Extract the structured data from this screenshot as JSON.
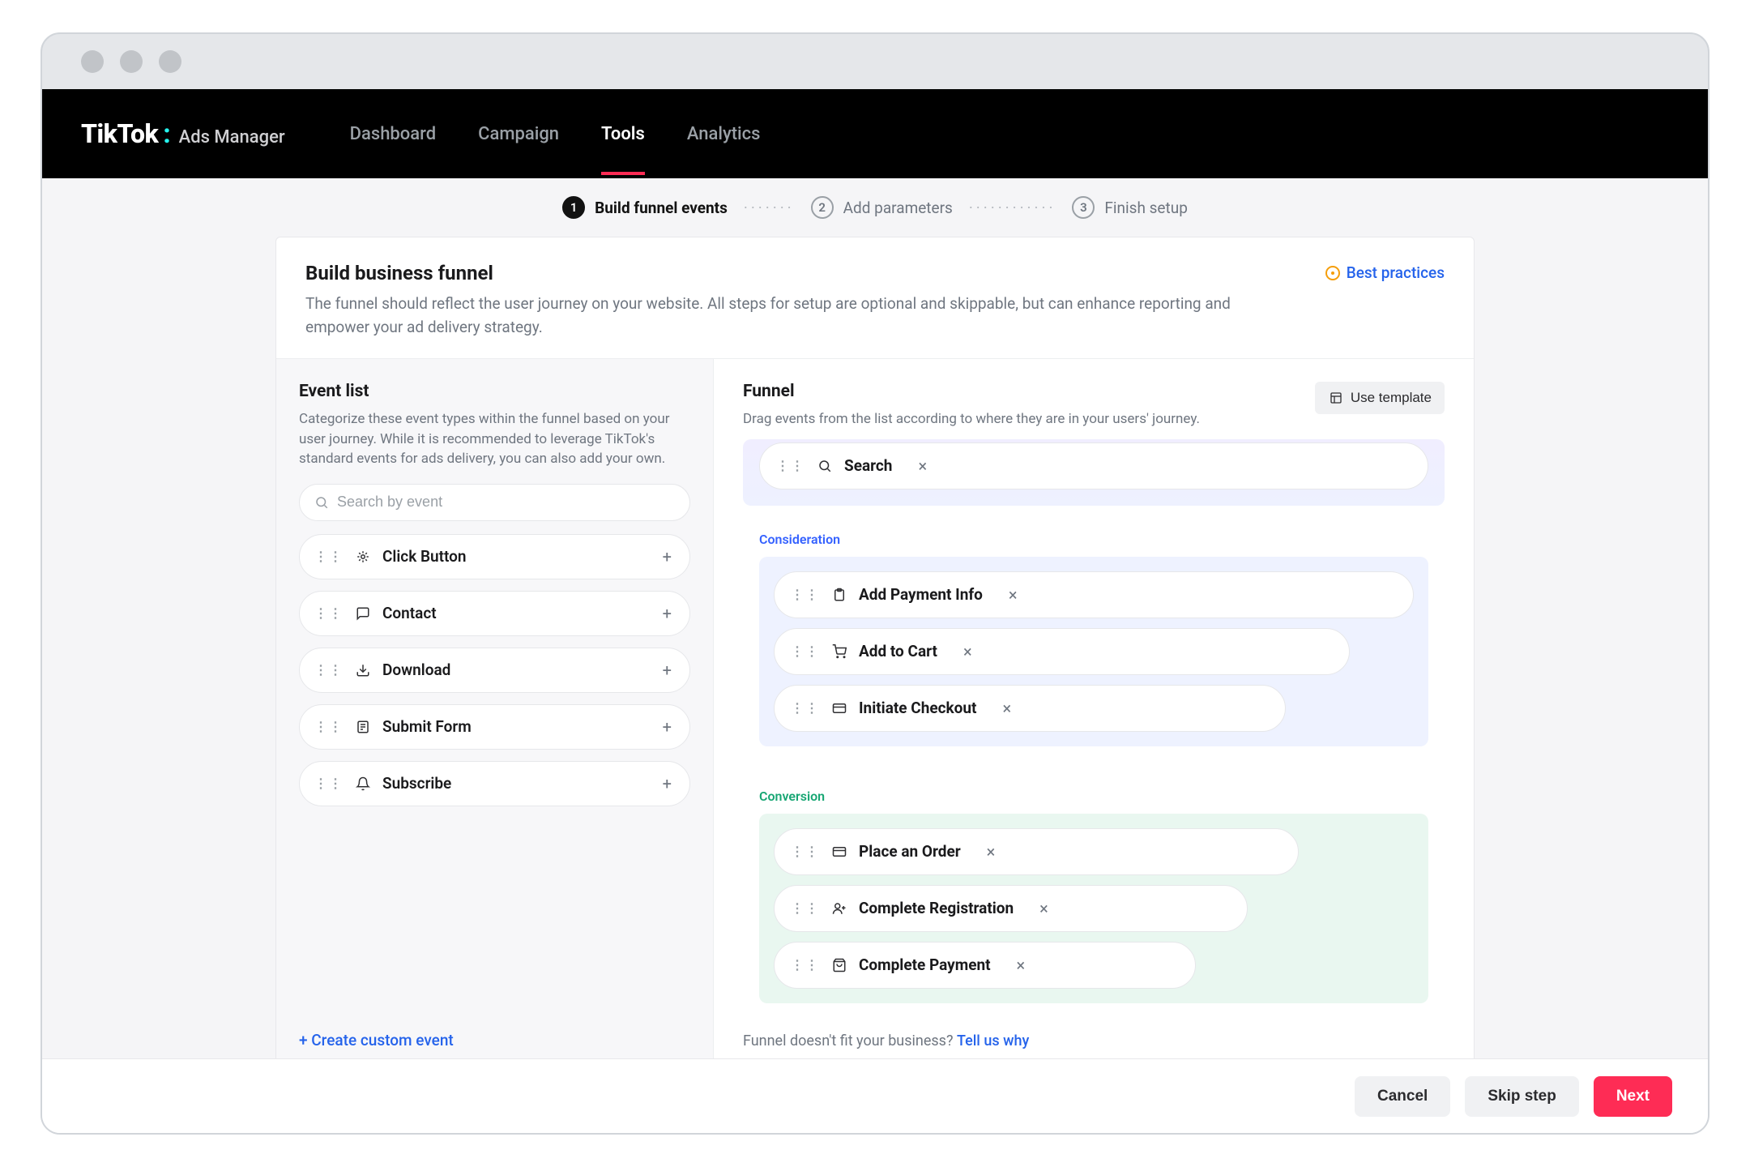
{
  "brand": {
    "logo": "TikTok",
    "sub": "Ads Manager"
  },
  "nav": {
    "items": [
      "Dashboard",
      "Campaign",
      "Tools",
      "Analytics"
    ],
    "activeIndex": 2
  },
  "stepper": {
    "steps": [
      {
        "num": "1",
        "label": "Build funnel events"
      },
      {
        "num": "2",
        "label": "Add parameters"
      },
      {
        "num": "3",
        "label": "Finish setup"
      }
    ]
  },
  "header": {
    "title": "Build business funnel",
    "description": "The funnel should reflect the user journey on your website. All steps for setup are optional and skippable, but can enhance reporting and empower your ad delivery strategy.",
    "best_practices": "Best practices"
  },
  "eventList": {
    "title": "Event list",
    "description": "Categorize these event types within the funnel based on your user journey. While it is recommended to leverage TikTok's standard events for ads delivery, you can also add your own.",
    "search_placeholder": "Search by event",
    "items": [
      {
        "label": "Click Button",
        "icon": "click"
      },
      {
        "label": "Contact",
        "icon": "chat"
      },
      {
        "label": "Download",
        "icon": "download"
      },
      {
        "label": "Submit Form",
        "icon": "form"
      },
      {
        "label": "Subscribe",
        "icon": "bell"
      }
    ],
    "create_custom": "Create custom event"
  },
  "funnel": {
    "title": "Funnel",
    "description": "Drag events from the list according to where they are in your users' journey.",
    "use_template": "Use template",
    "stages": {
      "awareness": {
        "items": [
          {
            "label": "Search",
            "icon": "search"
          }
        ]
      },
      "consideration": {
        "title": "Consideration",
        "items": [
          {
            "label": "Add Payment Info",
            "icon": "clipboard"
          },
          {
            "label": "Add to Cart",
            "icon": "cart"
          },
          {
            "label": "Initiate Checkout",
            "icon": "card"
          }
        ]
      },
      "conversion": {
        "title": "Conversion",
        "items": [
          {
            "label": "Place an Order",
            "icon": "card"
          },
          {
            "label": "Complete Registration",
            "icon": "user"
          },
          {
            "label": "Complete Payment",
            "icon": "bag"
          }
        ]
      }
    },
    "footer_text": "Funnel doesn't fit your business? ",
    "footer_link": "Tell us why"
  },
  "footer": {
    "cancel": "Cancel",
    "skip": "Skip step",
    "next": "Next"
  }
}
